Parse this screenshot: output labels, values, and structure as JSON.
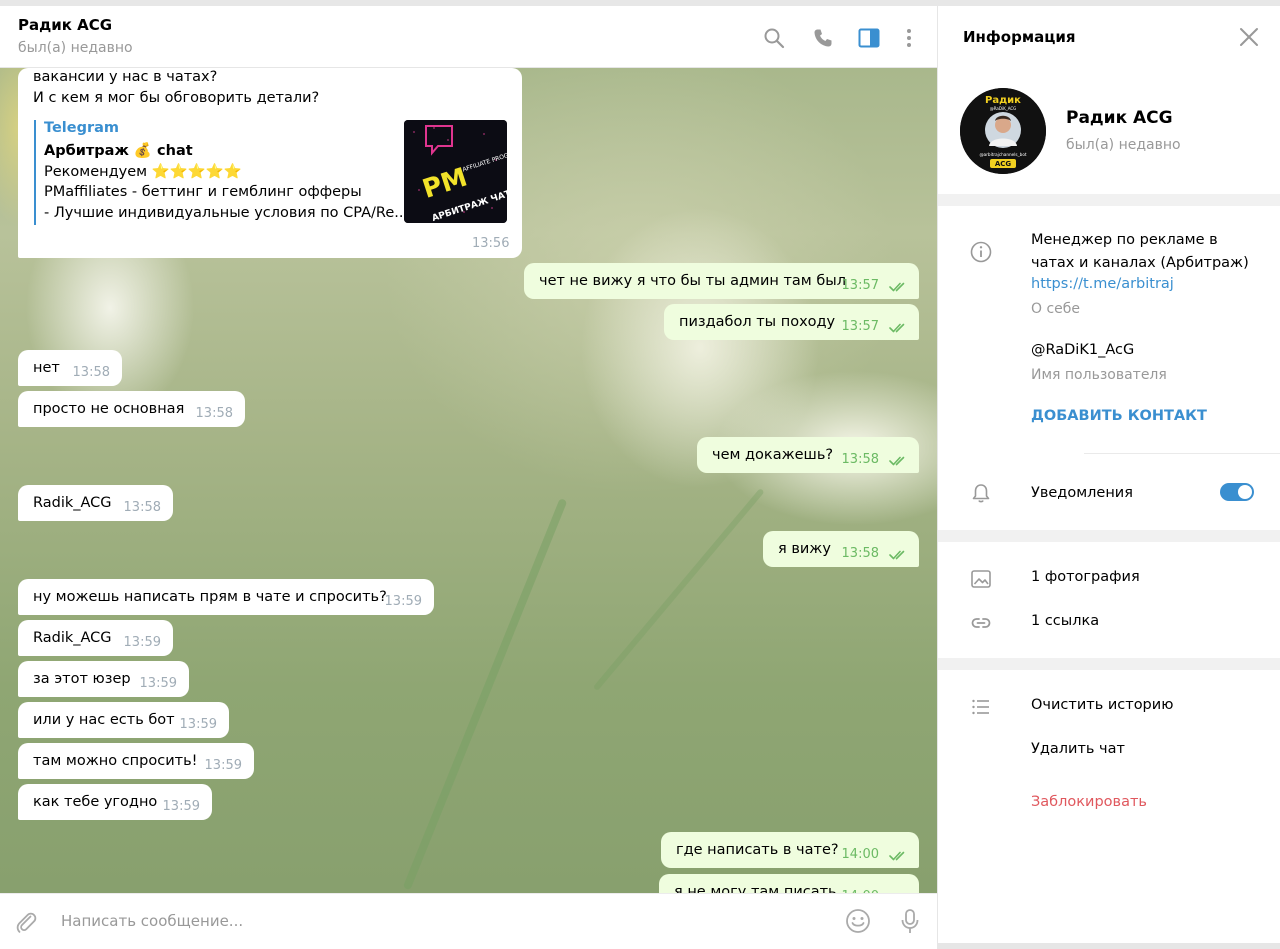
{
  "chat": {
    "title": "Радик ACG",
    "status": "был(а) недавно",
    "input_placeholder": "Написать сообщение..."
  },
  "link_message": {
    "line1": "вакансии у нас в чатах?",
    "line2": "И с кем я мог бы обговорить детали?",
    "preview_site": "Telegram",
    "preview_title": "Арбитраж 💰 chat",
    "preview_line1": "Рекомендуем ⭐⭐⭐⭐⭐",
    "preview_line2": "PMaffiliates - беттинг и гемблинг офферы",
    "preview_line3": "- Лучшие индивидуальные условия по CPA/Re...",
    "thumb_main": "PM",
    "thumb_side": "AFFILIATE PROGRAM",
    "thumb_bottom": "АРБИТРАЖ ЧАТ",
    "time": "13:56"
  },
  "messages": [
    {
      "dir": "out",
      "text": "чет не вижу я что бы ты админ там был",
      "time": "13:57"
    },
    {
      "dir": "out",
      "text": "пиздабол ты походу",
      "time": "13:57"
    },
    {
      "dir": "in",
      "text": "нет",
      "time": "13:58"
    },
    {
      "dir": "in",
      "text": "просто не основная",
      "time": "13:58"
    },
    {
      "dir": "out",
      "text": "чем докажешь?",
      "time": "13:58"
    },
    {
      "dir": "in",
      "text": "Radik_ACG",
      "time": "13:58"
    },
    {
      "dir": "out",
      "text": "я вижу",
      "time": "13:58"
    },
    {
      "dir": "in",
      "text": "ну можешь написать прям в чате и спросить?",
      "time": "13:59"
    },
    {
      "dir": "in",
      "text": "Radik_ACG",
      "time": "13:59"
    },
    {
      "dir": "in",
      "text": "за этот юзер",
      "time": "13:59"
    },
    {
      "dir": "in",
      "text": "или у нас есть бот",
      "time": "13:59"
    },
    {
      "dir": "in",
      "text": "там можно спросить!",
      "time": "13:59"
    },
    {
      "dir": "in",
      "text": "как тебе угодно",
      "time": "13:59"
    },
    {
      "dir": "out",
      "text": "где написать в чате?",
      "time": "14:00"
    },
    {
      "dir": "out",
      "text": "я не могу там писать",
      "time": "14:00"
    }
  ],
  "info": {
    "title": "Информация",
    "name": "Радик ACG",
    "status": "был(а) недавно",
    "avatar_top": "Радик",
    "avatar_handle": "@RaDiK_ACG",
    "avatar_bottom_handle": "@arbitrajchannels_bot",
    "avatar_badge": "ACG",
    "bio_line1": "Менеджер по рекламе в",
    "bio_line2": "чатах и каналах (Арбитраж)",
    "bio_link": "https://t.me/arbitraj",
    "bio_label": "О себе",
    "username": "@RaDiK1_AcG",
    "username_label": "Имя пользователя",
    "add_contact": "ДОБАВИТЬ КОНТАКТ",
    "notifications": "Уведомления",
    "notifications_on": true,
    "photos": "1 фотография",
    "links": "1 ссылка",
    "clear_history": "Очистить историю",
    "delete_chat": "Удалить чат",
    "block": "Заблокировать"
  },
  "colors": {
    "accent": "#3a8fd0",
    "out_bubble": "#effdde",
    "danger": "#e0585e",
    "read_check": "#6cba64"
  }
}
